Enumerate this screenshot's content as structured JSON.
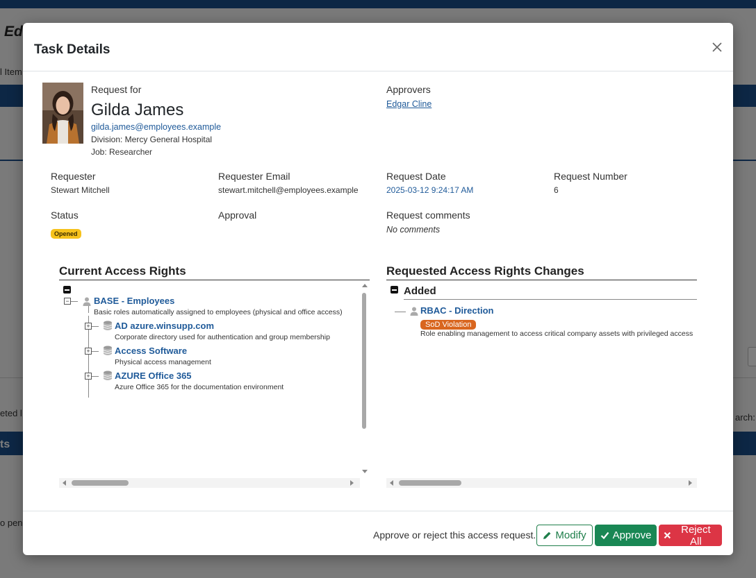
{
  "background": {
    "title_fragment": "Edg",
    "crumb_fragment": "l Item",
    "left_fragment_1": "eted l",
    "band_fragment": "ts",
    "left_fragment_2": "o pen",
    "search_fragment": "arch:"
  },
  "modal": {
    "title": "Task Details",
    "close_icon": "close-icon"
  },
  "request_for": {
    "label": "Request for",
    "name": "Gilda James",
    "email": "gilda.james@employees.example",
    "division": "Division: Mercy General Hospital",
    "job": "Job: Researcher"
  },
  "approvers": {
    "label": "Approvers",
    "items": [
      "Edgar Cline"
    ]
  },
  "details": {
    "requester_label": "Requester",
    "requester_value": "Stewart Mitchell",
    "requester_email_label": "Requester Email",
    "requester_email_value": "stewart.mitchell@employees.example",
    "request_date_label": "Request Date",
    "request_date_value": "2025-03-12 9:24:17 AM",
    "request_number_label": "Request Number",
    "request_number_value": "6",
    "status_label": "Status",
    "status_value": "Opened",
    "approval_label": "Approval",
    "comments_label": "Request comments",
    "comments_value": "No comments"
  },
  "current_rights": {
    "title": "Current Access Rights",
    "root": {
      "name": "BASE - Employees",
      "desc": "Basic roles automatically assigned to employees (physical and office access)",
      "icon": "user-role-icon"
    },
    "children": [
      {
        "name": "AD azure.winsupp.com",
        "desc": "Corporate directory used for authentication and group membership",
        "icon": "database-icon"
      },
      {
        "name": "Access Software",
        "desc": "Physical access management",
        "icon": "database-icon"
      },
      {
        "name": "AZURE Office 365",
        "desc": "Azure Office 365 for the documentation environment",
        "icon": "database-icon"
      }
    ]
  },
  "requested_changes": {
    "title": "Requested Access Rights Changes",
    "group_label": "Added",
    "item": {
      "name": "RBAC - Direction",
      "badge": "SoD Violation",
      "desc": "Role enabling management to access critical company assets with privileged access",
      "icon": "user-role-icon"
    }
  },
  "footer": {
    "prompt": "Approve or reject this access request.",
    "modify_label": "Modify",
    "approve_label": "Approve",
    "reject_label": "Reject All"
  },
  "colors": {
    "accent": "#1b4f8a",
    "link": "#1f5a99",
    "status_opened": "#f6c21c",
    "sod_badge": "#d9661f",
    "approve": "#198754",
    "reject": "#dc3545"
  }
}
